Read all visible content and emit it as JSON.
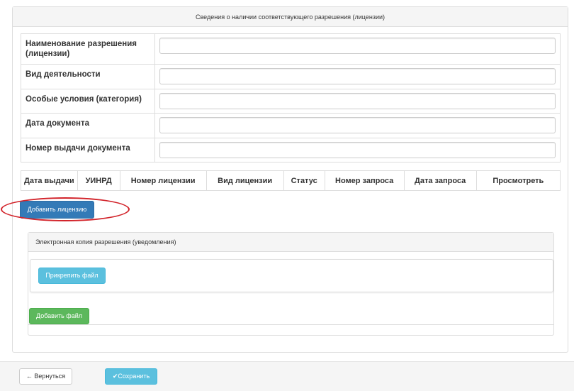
{
  "panel": {
    "title": "Сведения о наличии соответствующего разрешения (лицензии)"
  },
  "form": {
    "fields": [
      {
        "label": "Наименование разрешения (лицензии)",
        "value": ""
      },
      {
        "label": "Вид деятельности",
        "value": ""
      },
      {
        "label": "Особые условия (категория)",
        "value": ""
      },
      {
        "label": "Дата документа",
        "value": ""
      },
      {
        "label": "Номер выдачи документа",
        "value": ""
      }
    ]
  },
  "license_table": {
    "columns": [
      "Дата выдачи",
      "УИНРД",
      "Номер лицензии",
      "Вид лицензии",
      "Статус",
      "Номер запроса",
      "Дата запроса",
      "Просмотреть"
    ]
  },
  "add_license_button": "Добавить лицензию",
  "attachment": {
    "title": "Электронная копия разрешения (уведомления)",
    "attach_button": "Прикрепить файл",
    "add_file_button": "Добавить файл"
  },
  "footer": {
    "back_icon": "arrow-left-icon",
    "back_label": "Вернуться",
    "save_icon": "checkmark-icon",
    "save_label": "Сохранить"
  },
  "colors": {
    "primary": "#337ab7",
    "info": "#5bc0de",
    "success": "#5cb85c",
    "highlight": "#d2232a"
  }
}
